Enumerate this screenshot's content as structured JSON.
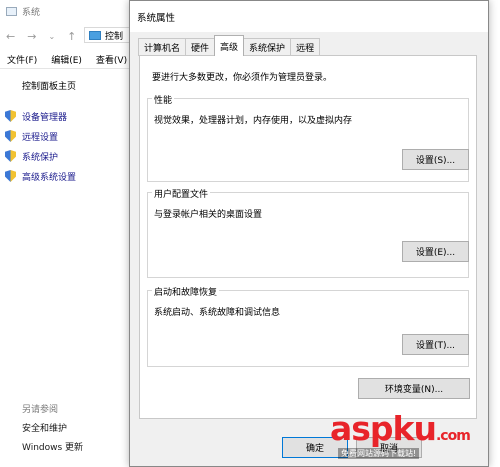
{
  "background_window": {
    "title": "系统",
    "address_text": "控制",
    "menu": [
      "文件(F)",
      "编辑(E)",
      "查看(V)"
    ],
    "home_link": "控制面板主页",
    "nav_links": [
      "设备管理器",
      "远程设置",
      "系统保护",
      "高级系统设置"
    ],
    "see_also_title": "另请参阅",
    "see_also_links": [
      "安全和维护",
      "Windows 更新"
    ]
  },
  "dialog": {
    "title": "系统属性",
    "tabs": [
      "计算机名",
      "硬件",
      "高级",
      "系统保护",
      "远程"
    ],
    "active_tab_index": 2,
    "admin_note": "要进行大多数更改，你必须作为管理员登录。",
    "groups": [
      {
        "title": "性能",
        "description": "视觉效果，处理器计划，内存使用，以及虚拟内存",
        "button": "设置(S)..."
      },
      {
        "title": "用户配置文件",
        "description": "与登录帐户相关的桌面设置",
        "button": "设置(E)..."
      },
      {
        "title": "启动和故障恢复",
        "description": "系统启动、系统故障和调试信息",
        "button": "设置(T)..."
      }
    ],
    "env_button": "环境变量(N)...",
    "ok_button": "确定",
    "cancel_button": "取消"
  },
  "watermark": {
    "brand": "aspku",
    "brand_tld": ".com",
    "tagline": "免费网站源码下载站!",
    "colors": {
      "asp": "#e8242a",
      "ku": "#2a6fd6"
    }
  }
}
